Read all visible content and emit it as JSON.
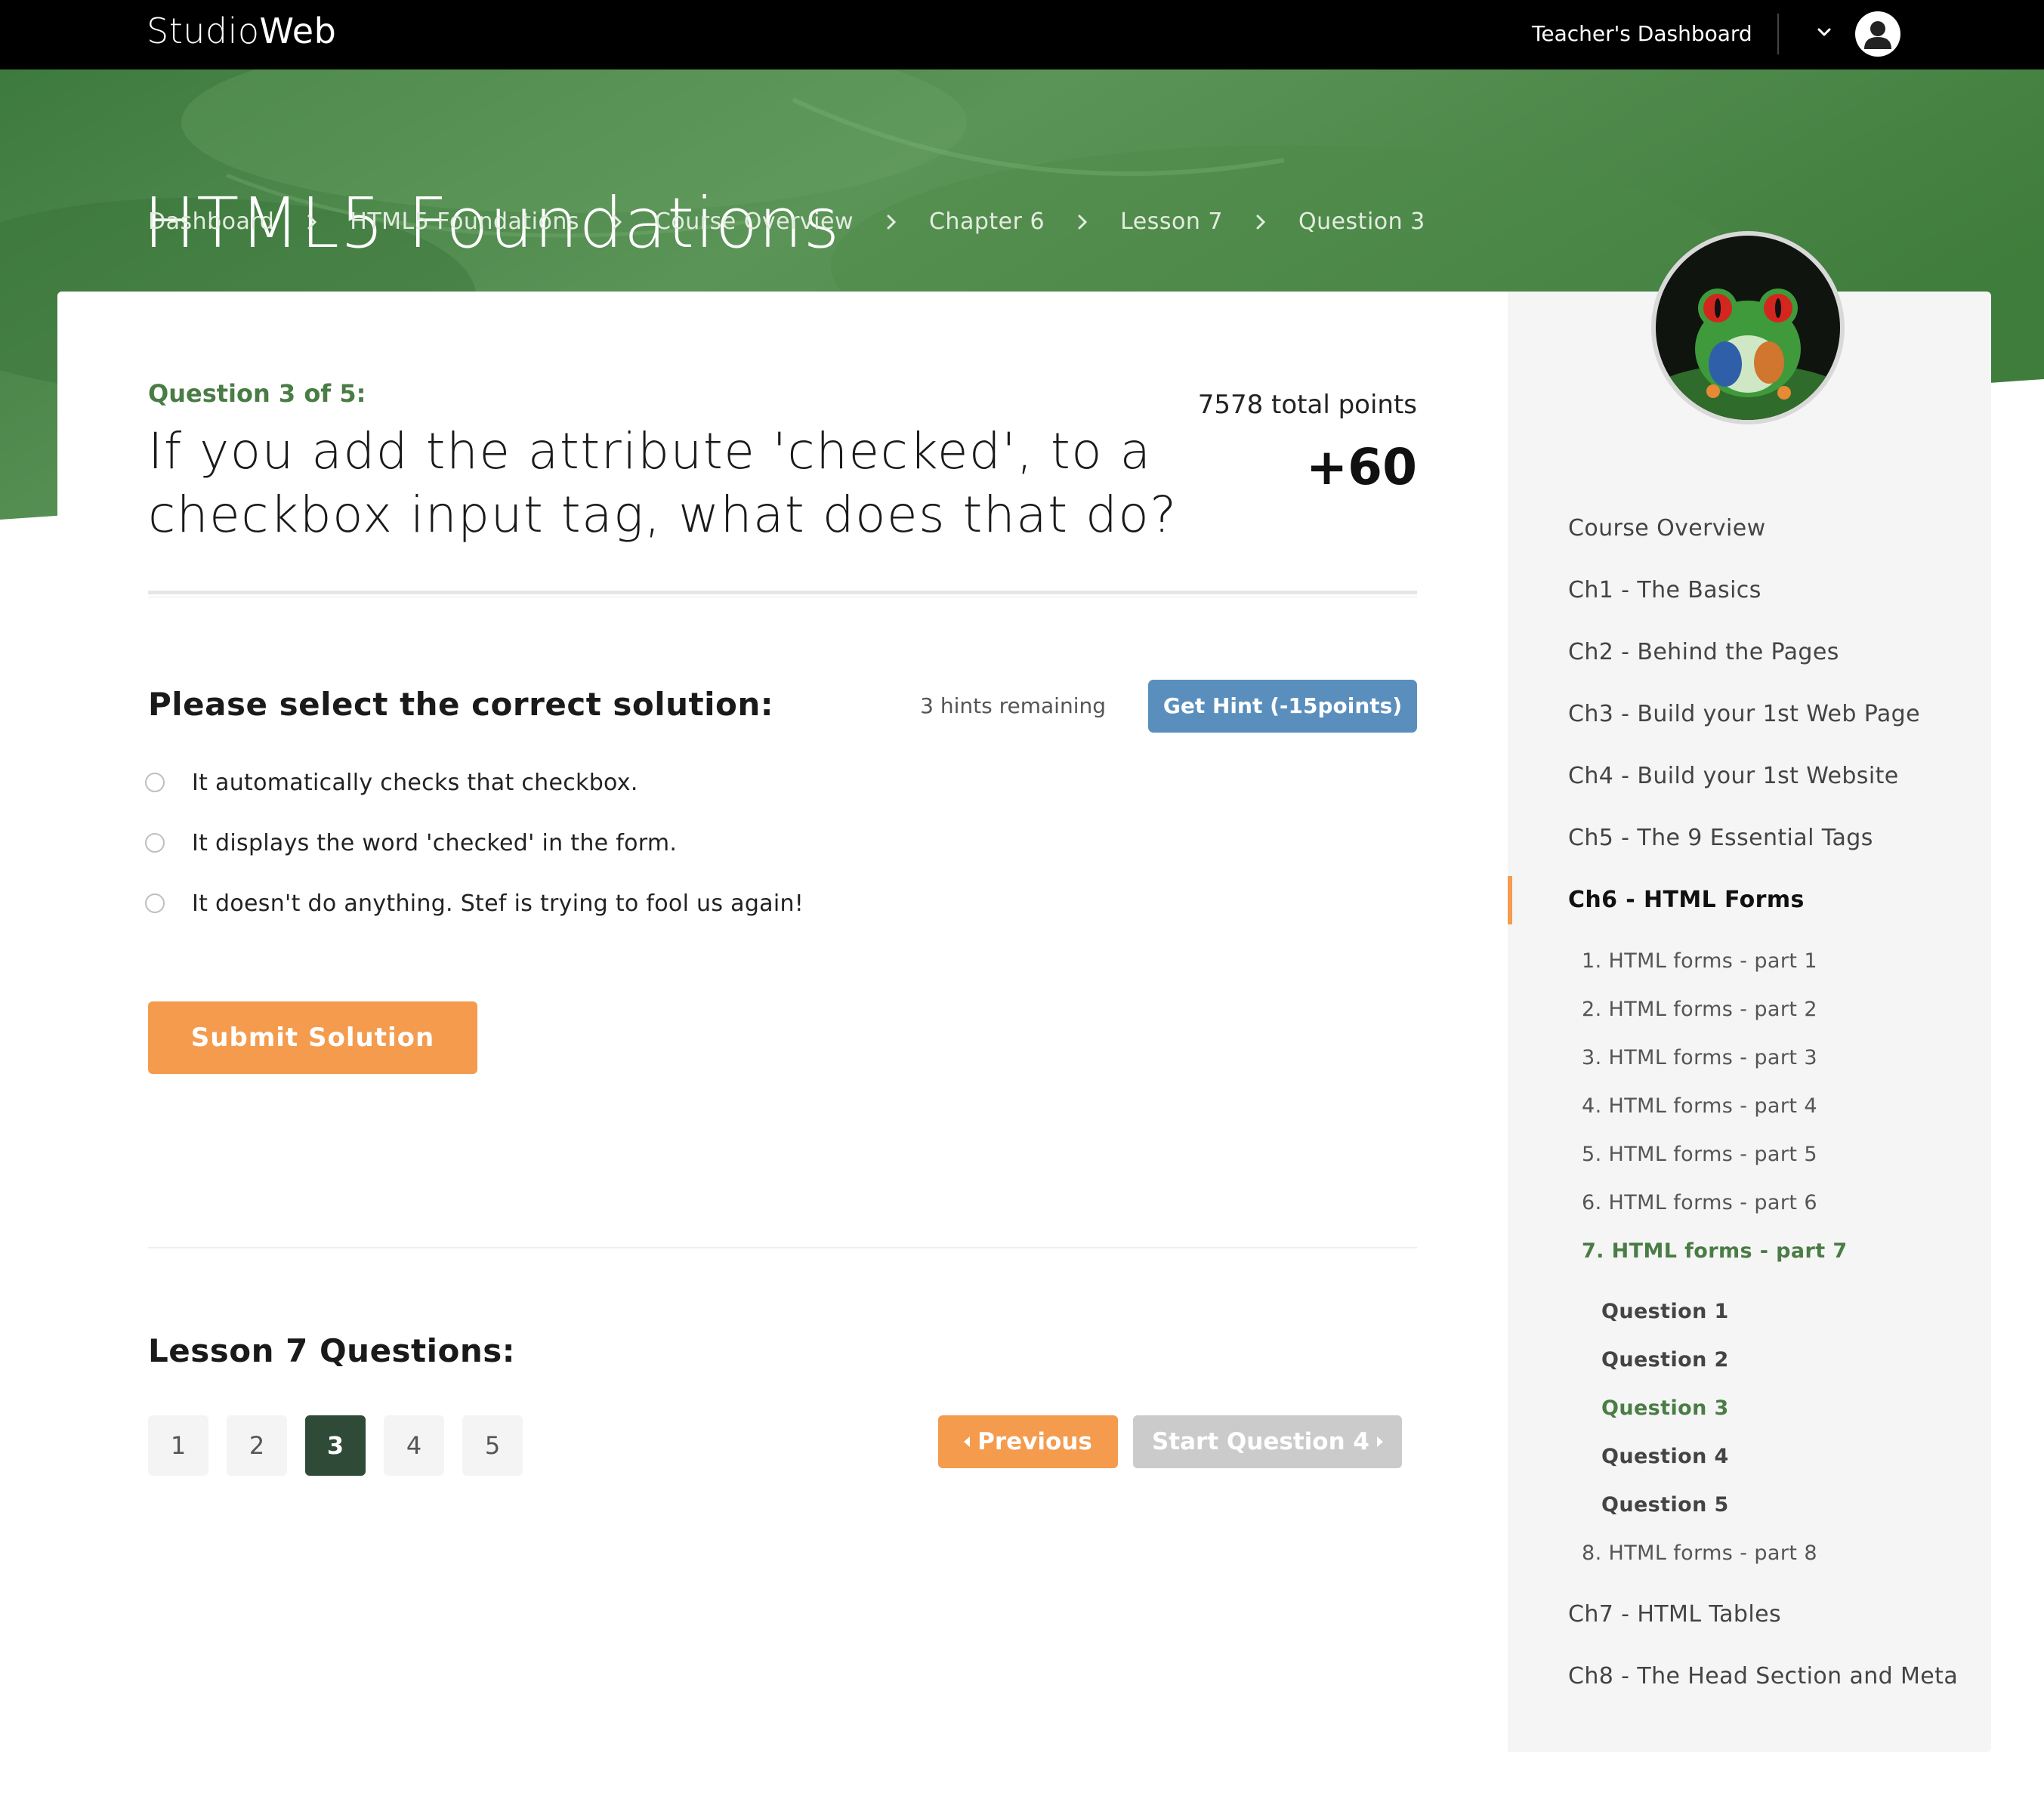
{
  "topbar": {
    "logo_light": "Studio",
    "logo_bold": "Web",
    "dashboard_link": "Teacher's Dashboard"
  },
  "hero": {
    "course_title": "HTML5 Foundations",
    "breadcrumb": [
      "Dashboard",
      "HTML5 Foundations",
      "Course Overview",
      "Chapter 6",
      "Lesson 7",
      "Question 3"
    ]
  },
  "question": {
    "label": "Question 3 of 5:",
    "text": "If you add the attribute 'checked', to a checkbox input tag, what does that do?",
    "total_points": "7578 total points",
    "points_gain": "+60"
  },
  "answers": {
    "heading": "Please select the correct solution:",
    "hints_remaining": "3 hints remaining",
    "hint_button": "Get Hint (-15points)",
    "options": [
      "It automatically checks that checkbox.",
      "It displays the word 'checked' in the form.",
      "It doesn't do anything. Stef is trying to fool us again!"
    ],
    "submit_button": "Submit Solution"
  },
  "lesson": {
    "heading": "Lesson 7 Questions:",
    "question_numbers": [
      "1",
      "2",
      "3",
      "4",
      "5"
    ],
    "active_question": "3",
    "previous_button": "Previous",
    "next_button": "Start Question 4"
  },
  "sidebar": {
    "chapters_before": [
      "Course Overview",
      "Ch1 - The Basics",
      "Ch2 - Behind the Pages",
      "Ch3 - Build your 1st Web Page",
      "Ch4 - Build your 1st Website",
      "Ch5 - The 9 Essential Tags"
    ],
    "current_chapter": "Ch6 - HTML Forms",
    "lessons": [
      "1. HTML forms - part 1",
      "2. HTML forms - part 2",
      "3. HTML forms - part 3",
      "4. HTML forms - part 4",
      "5. HTML forms - part 5",
      "6. HTML forms - part 6",
      "7. HTML forms - part 7"
    ],
    "lesson_questions": [
      "Question 1",
      "Question 2",
      "Question 3",
      "Question 4",
      "Question 5"
    ],
    "lesson_after": "8. HTML forms - part 8",
    "chapters_after": [
      "Ch7 - HTML Tables",
      "Ch8 - The Head Section and Meta"
    ]
  },
  "colors": {
    "accent_green": "#4a7c45",
    "accent_orange": "#f49b4e",
    "hint_blue": "#5a8fbd",
    "active_page": "#2f4b38"
  },
  "icons": [
    "chevron-right-icon",
    "chevron-down-icon",
    "user-icon",
    "radio-icon",
    "caret-left-icon",
    "caret-right-icon"
  ]
}
